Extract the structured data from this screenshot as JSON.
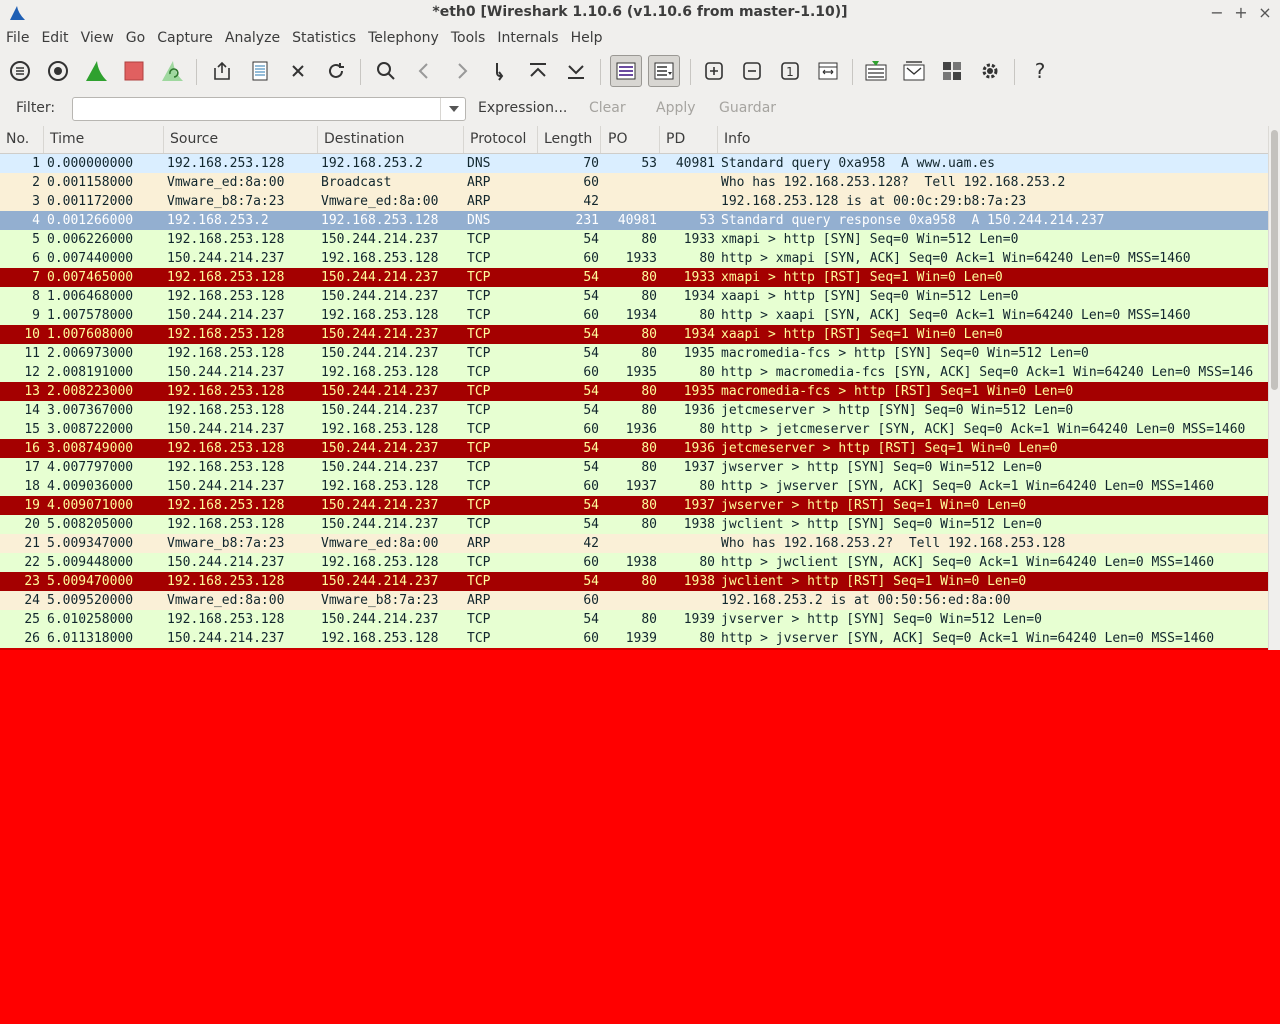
{
  "window": {
    "title": "*eth0  [Wireshark 1.10.6  (v1.10.6 from master-1.10)]",
    "controls": [
      "−",
      "+",
      "×"
    ]
  },
  "menu": [
    "File",
    "Edit",
    "View",
    "Go",
    "Capture",
    "Analyze",
    "Statistics",
    "Telephony",
    "Tools",
    "Internals",
    "Help"
  ],
  "toolbar": {
    "icons": [
      "interfaces-icon",
      "capture-options-icon",
      "start-capture-icon",
      "stop-capture-icon",
      "restart-capture-icon",
      "open-file-icon",
      "save-file-icon",
      "close-file-icon",
      "reload-icon",
      "find-packet-icon",
      "go-back-icon",
      "go-forward-icon",
      "go-to-packet-icon",
      "go-first-icon",
      "go-last-icon",
      "colorize-icon",
      "auto-scroll-icon",
      "zoom-in-icon",
      "zoom-out-icon",
      "normal-size-icon",
      "resize-columns-icon",
      "capture-filters-icon",
      "display-filters-icon",
      "coloring-rules-icon",
      "preferences-icon",
      "help-icon"
    ],
    "help_glyph": "?",
    "normal_size_glyph": "1"
  },
  "filter": {
    "label": "Filter:",
    "value": "",
    "expression": "Expression...",
    "clear": "Clear",
    "apply": "Apply",
    "save": "Guardar"
  },
  "columns": [
    "No.",
    "Time",
    "Source",
    "Destination",
    "Protocol",
    "Length",
    "PO",
    "PD",
    "Info"
  ],
  "colors": {
    "dns_bg": "#daeeff",
    "arp_bg": "#faf0d7",
    "tcp_bg": "#e7ffd2",
    "rst_bg": "#a40000",
    "rst_fg": "#fffc9c",
    "selected_bg": "#93afd0",
    "selected_fg": "#ffffff",
    "capture_start": "#2fa12f",
    "capture_stop": "#e06060"
  },
  "packets": [
    {
      "no": "1",
      "time": "0.000000000",
      "src": "192.168.253.128",
      "dst": "192.168.253.2",
      "proto": "DNS",
      "len": "70",
      "po": "53",
      "pd": "40981",
      "info": "Standard query 0xa958  A www.uam.es",
      "style": "dns"
    },
    {
      "no": "2",
      "time": "0.001158000",
      "src": "Vmware_ed:8a:00",
      "dst": "Broadcast",
      "proto": "ARP",
      "len": "60",
      "po": "",
      "pd": "",
      "info": "Who has 192.168.253.128?  Tell 192.168.253.2",
      "style": "arp"
    },
    {
      "no": "3",
      "time": "0.001172000",
      "src": "Vmware_b8:7a:23",
      "dst": "Vmware_ed:8a:00",
      "proto": "ARP",
      "len": "42",
      "po": "",
      "pd": "",
      "info": "192.168.253.128 is at 00:0c:29:b8:7a:23",
      "style": "arp"
    },
    {
      "no": "4",
      "time": "0.001266000",
      "src": "192.168.253.2",
      "dst": "192.168.253.128",
      "proto": "DNS",
      "len": "231",
      "po": "40981",
      "pd": "53",
      "info": "Standard query response 0xa958  A 150.244.214.237",
      "style": "selected"
    },
    {
      "no": "5",
      "time": "0.006226000",
      "src": "192.168.253.128",
      "dst": "150.244.214.237",
      "proto": "TCP",
      "len": "54",
      "po": "80",
      "pd": "1933",
      "info": "xmapi > http [SYN] Seq=0 Win=512 Len=0",
      "style": "tcp"
    },
    {
      "no": "6",
      "time": "0.007440000",
      "src": "150.244.214.237",
      "dst": "192.168.253.128",
      "proto": "TCP",
      "len": "60",
      "po": "1933",
      "pd": "80",
      "info": "http > xmapi [SYN, ACK] Seq=0 Ack=1 Win=64240 Len=0 MSS=1460",
      "style": "tcp"
    },
    {
      "no": "7",
      "time": "0.007465000",
      "src": "192.168.253.128",
      "dst": "150.244.214.237",
      "proto": "TCP",
      "len": "54",
      "po": "80",
      "pd": "1933",
      "info": "xmapi > http [RST] Seq=1 Win=0 Len=0",
      "style": "rst"
    },
    {
      "no": "8",
      "time": "1.006468000",
      "src": "192.168.253.128",
      "dst": "150.244.214.237",
      "proto": "TCP",
      "len": "54",
      "po": "80",
      "pd": "1934",
      "info": "xaapi > http [SYN] Seq=0 Win=512 Len=0",
      "style": "tcp"
    },
    {
      "no": "9",
      "time": "1.007578000",
      "src": "150.244.214.237",
      "dst": "192.168.253.128",
      "proto": "TCP",
      "len": "60",
      "po": "1934",
      "pd": "80",
      "info": "http > xaapi [SYN, ACK] Seq=0 Ack=1 Win=64240 Len=0 MSS=1460",
      "style": "tcp"
    },
    {
      "no": "10",
      "time": "1.007608000",
      "src": "192.168.253.128",
      "dst": "150.244.214.237",
      "proto": "TCP",
      "len": "54",
      "po": "80",
      "pd": "1934",
      "info": "xaapi > http [RST] Seq=1 Win=0 Len=0",
      "style": "rst"
    },
    {
      "no": "11",
      "time": "2.006973000",
      "src": "192.168.253.128",
      "dst": "150.244.214.237",
      "proto": "TCP",
      "len": "54",
      "po": "80",
      "pd": "1935",
      "info": "macromedia-fcs > http [SYN] Seq=0 Win=512 Len=0",
      "style": "tcp"
    },
    {
      "no": "12",
      "time": "2.008191000",
      "src": "150.244.214.237",
      "dst": "192.168.253.128",
      "proto": "TCP",
      "len": "60",
      "po": "1935",
      "pd": "80",
      "info": "http > macromedia-fcs [SYN, ACK] Seq=0 Ack=1 Win=64240 Len=0 MSS=146",
      "style": "tcp"
    },
    {
      "no": "13",
      "time": "2.008223000",
      "src": "192.168.253.128",
      "dst": "150.244.214.237",
      "proto": "TCP",
      "len": "54",
      "po": "80",
      "pd": "1935",
      "info": "macromedia-fcs > http [RST] Seq=1 Win=0 Len=0",
      "style": "rst"
    },
    {
      "no": "14",
      "time": "3.007367000",
      "src": "192.168.253.128",
      "dst": "150.244.214.237",
      "proto": "TCP",
      "len": "54",
      "po": "80",
      "pd": "1936",
      "info": "jetcmeserver > http [SYN] Seq=0 Win=512 Len=0",
      "style": "tcp"
    },
    {
      "no": "15",
      "time": "3.008722000",
      "src": "150.244.214.237",
      "dst": "192.168.253.128",
      "proto": "TCP",
      "len": "60",
      "po": "1936",
      "pd": "80",
      "info": "http > jetcmeserver [SYN, ACK] Seq=0 Ack=1 Win=64240 Len=0 MSS=1460",
      "style": "tcp"
    },
    {
      "no": "16",
      "time": "3.008749000",
      "src": "192.168.253.128",
      "dst": "150.244.214.237",
      "proto": "TCP",
      "len": "54",
      "po": "80",
      "pd": "1936",
      "info": "jetcmeserver > http [RST] Seq=1 Win=0 Len=0",
      "style": "rst"
    },
    {
      "no": "17",
      "time": "4.007797000",
      "src": "192.168.253.128",
      "dst": "150.244.214.237",
      "proto": "TCP",
      "len": "54",
      "po": "80",
      "pd": "1937",
      "info": "jwserver > http [SYN] Seq=0 Win=512 Len=0",
      "style": "tcp"
    },
    {
      "no": "18",
      "time": "4.009036000",
      "src": "150.244.214.237",
      "dst": "192.168.253.128",
      "proto": "TCP",
      "len": "60",
      "po": "1937",
      "pd": "80",
      "info": "http > jwserver [SYN, ACK] Seq=0 Ack=1 Win=64240 Len=0 MSS=1460",
      "style": "tcp"
    },
    {
      "no": "19",
      "time": "4.009071000",
      "src": "192.168.253.128",
      "dst": "150.244.214.237",
      "proto": "TCP",
      "len": "54",
      "po": "80",
      "pd": "1937",
      "info": "jwserver > http [RST] Seq=1 Win=0 Len=0",
      "style": "rst"
    },
    {
      "no": "20",
      "time": "5.008205000",
      "src": "192.168.253.128",
      "dst": "150.244.214.237",
      "proto": "TCP",
      "len": "54",
      "po": "80",
      "pd": "1938",
      "info": "jwclient > http [SYN] Seq=0 Win=512 Len=0",
      "style": "tcp"
    },
    {
      "no": "21",
      "time": "5.009347000",
      "src": "Vmware_b8:7a:23",
      "dst": "Vmware_ed:8a:00",
      "proto": "ARP",
      "len": "42",
      "po": "",
      "pd": "",
      "info": "Who has 192.168.253.2?  Tell 192.168.253.128",
      "style": "arp"
    },
    {
      "no": "22",
      "time": "5.009448000",
      "src": "150.244.214.237",
      "dst": "192.168.253.128",
      "proto": "TCP",
      "len": "60",
      "po": "1938",
      "pd": "80",
      "info": "http > jwclient [SYN, ACK] Seq=0 Ack=1 Win=64240 Len=0 MSS=1460",
      "style": "tcp"
    },
    {
      "no": "23",
      "time": "5.009470000",
      "src": "192.168.253.128",
      "dst": "150.244.214.237",
      "proto": "TCP",
      "len": "54",
      "po": "80",
      "pd": "1938",
      "info": "jwclient > http [RST] Seq=1 Win=0 Len=0",
      "style": "rst"
    },
    {
      "no": "24",
      "time": "5.009520000",
      "src": "Vmware_ed:8a:00",
      "dst": "Vmware_b8:7a:23",
      "proto": "ARP",
      "len": "60",
      "po": "",
      "pd": "",
      "info": "192.168.253.2 is at 00:50:56:ed:8a:00",
      "style": "arp"
    },
    {
      "no": "25",
      "time": "6.010258000",
      "src": "192.168.253.128",
      "dst": "150.244.214.237",
      "proto": "TCP",
      "len": "54",
      "po": "80",
      "pd": "1939",
      "info": "jvserver > http [SYN] Seq=0 Win=512 Len=0",
      "style": "tcp"
    },
    {
      "no": "26",
      "time": "6.011318000",
      "src": "150.244.214.237",
      "dst": "192.168.253.128",
      "proto": "TCP",
      "len": "60",
      "po": "1939",
      "pd": "80",
      "info": "http > jvserver [SYN, ACK] Seq=0 Ack=1 Win=64240 Len=0 MSS=1460",
      "style": "tcp"
    }
  ]
}
